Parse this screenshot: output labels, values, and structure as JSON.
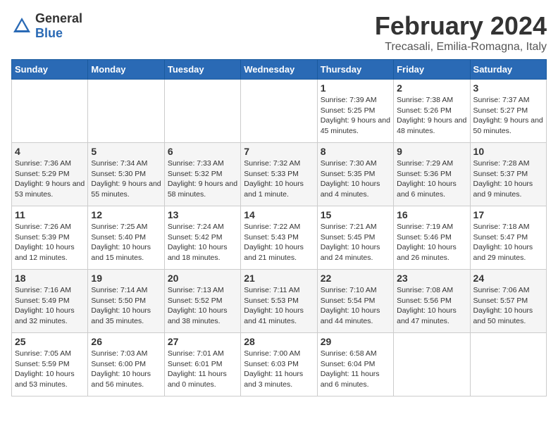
{
  "logo": {
    "text_general": "General",
    "text_blue": "Blue"
  },
  "title": "February 2024",
  "subtitle": "Trecasali, Emilia-Romagna, Italy",
  "days_of_week": [
    "Sunday",
    "Monday",
    "Tuesday",
    "Wednesday",
    "Thursday",
    "Friday",
    "Saturday"
  ],
  "weeks": [
    [
      {
        "day": "",
        "info": ""
      },
      {
        "day": "",
        "info": ""
      },
      {
        "day": "",
        "info": ""
      },
      {
        "day": "",
        "info": ""
      },
      {
        "day": "1",
        "info": "Sunrise: 7:39 AM\nSunset: 5:25 PM\nDaylight: 9 hours\nand 45 minutes."
      },
      {
        "day": "2",
        "info": "Sunrise: 7:38 AM\nSunset: 5:26 PM\nDaylight: 9 hours\nand 48 minutes."
      },
      {
        "day": "3",
        "info": "Sunrise: 7:37 AM\nSunset: 5:27 PM\nDaylight: 9 hours\nand 50 minutes."
      }
    ],
    [
      {
        "day": "4",
        "info": "Sunrise: 7:36 AM\nSunset: 5:29 PM\nDaylight: 9 hours\nand 53 minutes."
      },
      {
        "day": "5",
        "info": "Sunrise: 7:34 AM\nSunset: 5:30 PM\nDaylight: 9 hours\nand 55 minutes."
      },
      {
        "day": "6",
        "info": "Sunrise: 7:33 AM\nSunset: 5:32 PM\nDaylight: 9 hours\nand 58 minutes."
      },
      {
        "day": "7",
        "info": "Sunrise: 7:32 AM\nSunset: 5:33 PM\nDaylight: 10 hours\nand 1 minute."
      },
      {
        "day": "8",
        "info": "Sunrise: 7:30 AM\nSunset: 5:35 PM\nDaylight: 10 hours\nand 4 minutes."
      },
      {
        "day": "9",
        "info": "Sunrise: 7:29 AM\nSunset: 5:36 PM\nDaylight: 10 hours\nand 6 minutes."
      },
      {
        "day": "10",
        "info": "Sunrise: 7:28 AM\nSunset: 5:37 PM\nDaylight: 10 hours\nand 9 minutes."
      }
    ],
    [
      {
        "day": "11",
        "info": "Sunrise: 7:26 AM\nSunset: 5:39 PM\nDaylight: 10 hours\nand 12 minutes."
      },
      {
        "day": "12",
        "info": "Sunrise: 7:25 AM\nSunset: 5:40 PM\nDaylight: 10 hours\nand 15 minutes."
      },
      {
        "day": "13",
        "info": "Sunrise: 7:24 AM\nSunset: 5:42 PM\nDaylight: 10 hours\nand 18 minutes."
      },
      {
        "day": "14",
        "info": "Sunrise: 7:22 AM\nSunset: 5:43 PM\nDaylight: 10 hours\nand 21 minutes."
      },
      {
        "day": "15",
        "info": "Sunrise: 7:21 AM\nSunset: 5:45 PM\nDaylight: 10 hours\nand 24 minutes."
      },
      {
        "day": "16",
        "info": "Sunrise: 7:19 AM\nSunset: 5:46 PM\nDaylight: 10 hours\nand 26 minutes."
      },
      {
        "day": "17",
        "info": "Sunrise: 7:18 AM\nSunset: 5:47 PM\nDaylight: 10 hours\nand 29 minutes."
      }
    ],
    [
      {
        "day": "18",
        "info": "Sunrise: 7:16 AM\nSunset: 5:49 PM\nDaylight: 10 hours\nand 32 minutes."
      },
      {
        "day": "19",
        "info": "Sunrise: 7:14 AM\nSunset: 5:50 PM\nDaylight: 10 hours\nand 35 minutes."
      },
      {
        "day": "20",
        "info": "Sunrise: 7:13 AM\nSunset: 5:52 PM\nDaylight: 10 hours\nand 38 minutes."
      },
      {
        "day": "21",
        "info": "Sunrise: 7:11 AM\nSunset: 5:53 PM\nDaylight: 10 hours\nand 41 minutes."
      },
      {
        "day": "22",
        "info": "Sunrise: 7:10 AM\nSunset: 5:54 PM\nDaylight: 10 hours\nand 44 minutes."
      },
      {
        "day": "23",
        "info": "Sunrise: 7:08 AM\nSunset: 5:56 PM\nDaylight: 10 hours\nand 47 minutes."
      },
      {
        "day": "24",
        "info": "Sunrise: 7:06 AM\nSunset: 5:57 PM\nDaylight: 10 hours\nand 50 minutes."
      }
    ],
    [
      {
        "day": "25",
        "info": "Sunrise: 7:05 AM\nSunset: 5:59 PM\nDaylight: 10 hours\nand 53 minutes."
      },
      {
        "day": "26",
        "info": "Sunrise: 7:03 AM\nSunset: 6:00 PM\nDaylight: 10 hours\nand 56 minutes."
      },
      {
        "day": "27",
        "info": "Sunrise: 7:01 AM\nSunset: 6:01 PM\nDaylight: 11 hours\nand 0 minutes."
      },
      {
        "day": "28",
        "info": "Sunrise: 7:00 AM\nSunset: 6:03 PM\nDaylight: 11 hours\nand 3 minutes."
      },
      {
        "day": "29",
        "info": "Sunrise: 6:58 AM\nSunset: 6:04 PM\nDaylight: 11 hours\nand 6 minutes."
      },
      {
        "day": "",
        "info": ""
      },
      {
        "day": "",
        "info": ""
      }
    ]
  ]
}
